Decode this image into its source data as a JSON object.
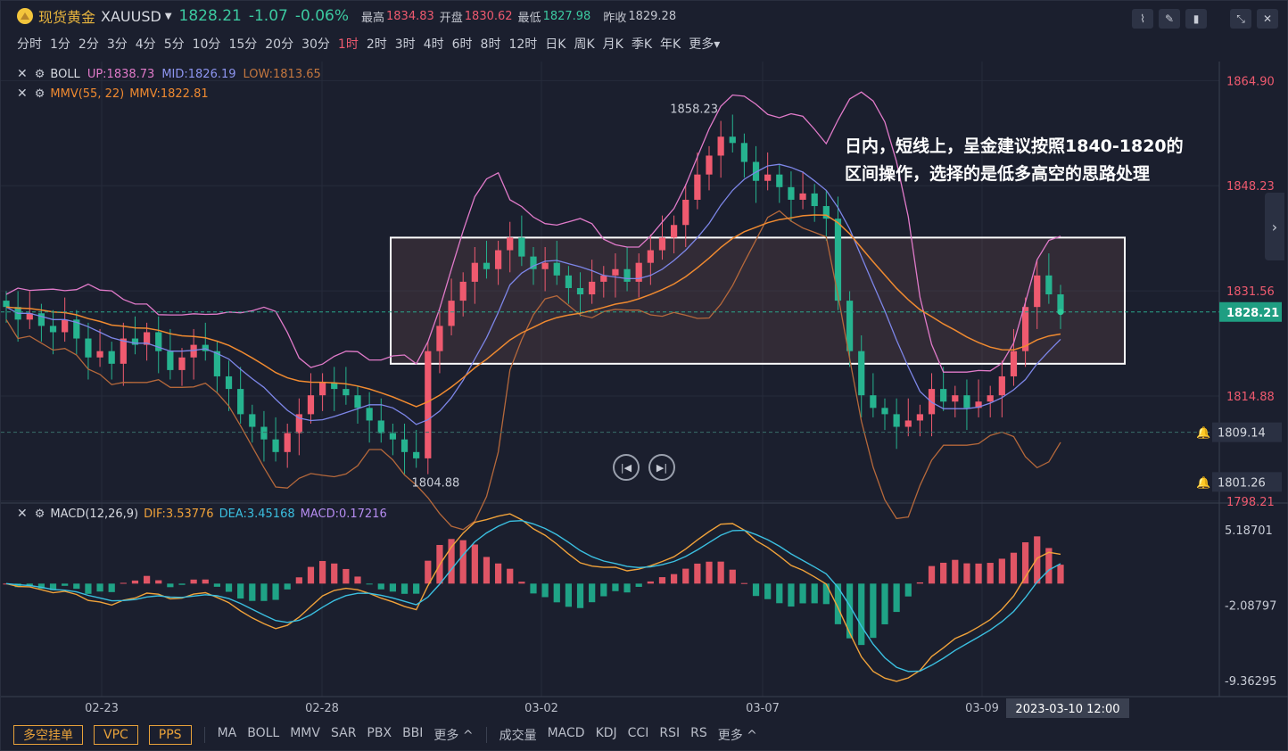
{
  "header": {
    "name": "现货黄金",
    "code": "XAUUSD",
    "price": "1828.21",
    "change": "-1.07",
    "change_pct": "-0.06%",
    "high_label": "最高",
    "high": "1834.83",
    "open_label": "开盘",
    "open": "1830.62",
    "low_label": "最低",
    "low": "1827.98",
    "prev_label": "昨收",
    "prev": "1829.28"
  },
  "periods": [
    "分时",
    "1分",
    "2分",
    "3分",
    "4分",
    "5分",
    "10分",
    "15分",
    "20分",
    "30分",
    "1时",
    "2时",
    "3时",
    "4时",
    "6时",
    "8时",
    "12时",
    "日K",
    "周K",
    "月K",
    "季K",
    "年K",
    "更多"
  ],
  "active_period": "1时",
  "legend_boll": {
    "name": "BOLL",
    "up": "UP:1838.73",
    "mid": "MID:1826.19",
    "low": "LOW:1813.65"
  },
  "legend_mmv": {
    "name": "MMV(55, 22)",
    "val": "MMV:1822.81"
  },
  "legend_macd": {
    "name": "MACD(12,26,9)",
    "dif": "DIF:3.53776",
    "dea": "DEA:3.45168",
    "macd": "MACD:0.17216"
  },
  "annotation": "日内，短线上，呈金建议按照1840-1820的区间操作，选择的是低多高空的思路处理",
  "markers": {
    "high": "1858.23",
    "low": "1804.88"
  },
  "crosshair_time": "2023-03-10 12:00",
  "price_tags": {
    "current": "1828.21",
    "alert1": "1809.14",
    "alert2": "1801.26"
  },
  "bottom": {
    "buttons": [
      "多空挂单",
      "VPC",
      "PPS"
    ],
    "main_inds": [
      "MA",
      "BOLL",
      "MMV",
      "SAR",
      "PBX",
      "BBI",
      "更多 ^"
    ],
    "sub_inds": [
      "成交量",
      "MACD",
      "KDJ",
      "CCI",
      "RSI",
      "RS",
      "更多 ^"
    ]
  },
  "colors": {
    "up": "#ef5a6f",
    "down": "#26b38f",
    "boll_up": "#e07ac9",
    "boll_mid": "#7d86e8",
    "boll_low": "#b5683b",
    "mmv": "#f08a30",
    "dif": "#f0a23a",
    "dea": "#3bbfe0"
  },
  "chart_data": {
    "type": "candlestick",
    "price_axis_ticks": [
      1864.9,
      1848.23,
      1831.56,
      1814.88,
      1798.21
    ],
    "ylim": [
      1796.5,
      1866.5
    ],
    "x_ticks": [
      "02-23",
      "02-28",
      "03-02",
      "03-07",
      "03-09"
    ],
    "range_box": {
      "upper": 1840,
      "lower": 1820
    },
    "close_series": [
      1829,
      1827,
      1828,
      1826,
      1825,
      1827,
      1824,
      1821,
      1822,
      1820,
      1824,
      1823,
      1825,
      1822,
      1819,
      1821,
      1823,
      1822,
      1818,
      1816,
      1812,
      1810,
      1808,
      1806,
      1809,
      1812,
      1815,
      1817,
      1816,
      1815,
      1813,
      1811,
      1809,
      1808,
      1806,
      1805,
      1822,
      1826,
      1830,
      1833,
      1836,
      1835,
      1838,
      1840,
      1837,
      1835,
      1836,
      1834,
      1832,
      1831,
      1833,
      1834,
      1835,
      1833,
      1836,
      1838,
      1840,
      1842,
      1846,
      1850,
      1853,
      1856,
      1855,
      1852,
      1849,
      1850,
      1848,
      1846,
      1847,
      1845,
      1843,
      1830,
      1822,
      1815,
      1813,
      1812,
      1810,
      1811,
      1812,
      1816,
      1814,
      1815,
      1813,
      1814,
      1815,
      1818,
      1822,
      1829,
      1834,
      1831,
      1828
    ],
    "macd_axis_ticks": [
      5.18701,
      -2.08797,
      -9.36295
    ]
  }
}
